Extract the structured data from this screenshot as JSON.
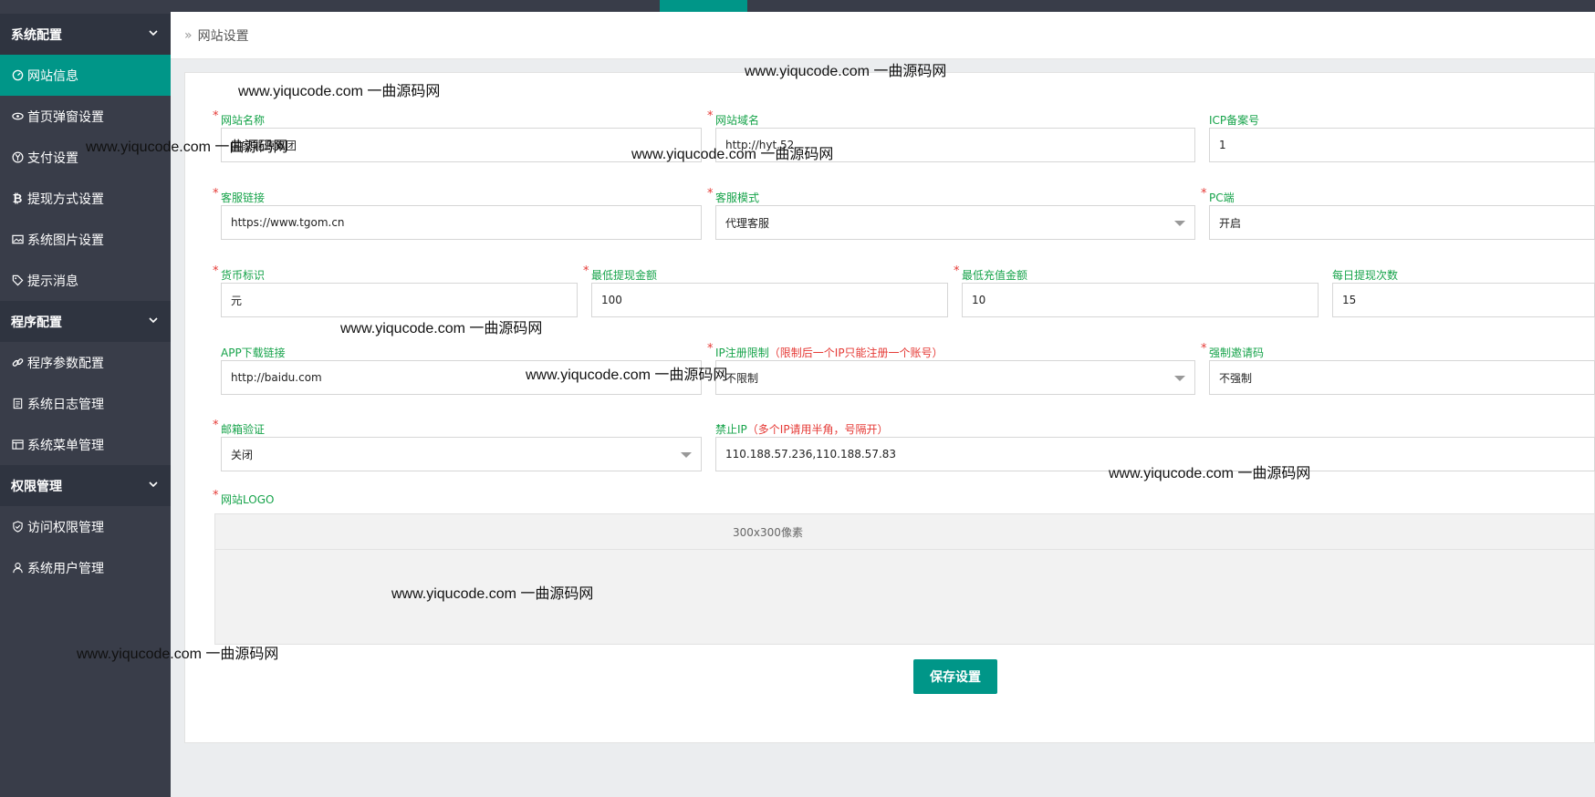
{
  "sidebar": {
    "groups": [
      {
        "label": "系统配置"
      },
      {
        "label": "程序配置"
      },
      {
        "label": "权限管理"
      }
    ],
    "items": [
      {
        "label": "网站信息",
        "icon": "dashboard-icon"
      },
      {
        "label": "首页弹窗设置",
        "icon": "eye-icon"
      },
      {
        "label": "支付设置",
        "icon": "yen-icon"
      },
      {
        "label": "提现方式设置",
        "icon": "bitcoin-icon"
      },
      {
        "label": "系统图片设置",
        "icon": "image-icon"
      },
      {
        "label": "提示消息",
        "icon": "tag-icon"
      },
      {
        "label": "程序参数配置",
        "icon": "link-icon"
      },
      {
        "label": "系统日志管理",
        "icon": "clipboard-icon"
      },
      {
        "label": "系统菜单管理",
        "icon": "window-icon"
      },
      {
        "label": "访问权限管理",
        "icon": "shield-icon"
      },
      {
        "label": "系统用户管理",
        "icon": "user-icon"
      }
    ]
  },
  "breadcrumb": {
    "label": "网站设置"
  },
  "form": {
    "site_name": {
      "label": "网站名称",
      "value": "国家能源集团"
    },
    "site_domain": {
      "label": "网站域名",
      "value": "http://hyt.52"
    },
    "icp": {
      "label": "ICP备案号",
      "value": "1"
    },
    "service_link": {
      "label": "客服链接",
      "value": "https://www.tgom.cn"
    },
    "service_mode": {
      "label": "客服模式",
      "value": "代理客服"
    },
    "pc_end": {
      "label": "PC端",
      "value": "开启"
    },
    "currency": {
      "label": "货币标识",
      "value": "元"
    },
    "min_withdraw": {
      "label": "最低提现金额",
      "value": "100"
    },
    "min_recharge": {
      "label": "最低充值金额",
      "value": "10"
    },
    "daily_withdraw": {
      "label": "每日提现次数",
      "value": "15"
    },
    "app_link": {
      "label": "APP下载链接",
      "value": "http://baidu.com"
    },
    "ip_limit": {
      "label": "IP注册限制",
      "hint": "（限制后一个IP只能注册一个账号）",
      "value": "不限制"
    },
    "force_invite": {
      "label": "强制邀请码",
      "value": "不强制"
    },
    "email_verify": {
      "label": "邮箱验证",
      "value": "关闭"
    },
    "ban_ip": {
      "label": "禁止IP",
      "hint": "（多个IP请用半角，号隔开）",
      "value": "110.188.57.236,110.188.57.83"
    },
    "site_logo": {
      "label": "网站LOGO",
      "size_hint": "300x300像素"
    }
  },
  "save_button": {
    "label": "保存设置"
  },
  "watermark": {
    "text": "www.yiqucode.com  一曲源码网"
  },
  "colors": {
    "accent": "#009688",
    "sidebar": "#393d49",
    "label_green": "#16a34a",
    "required_red": "#e53935"
  }
}
